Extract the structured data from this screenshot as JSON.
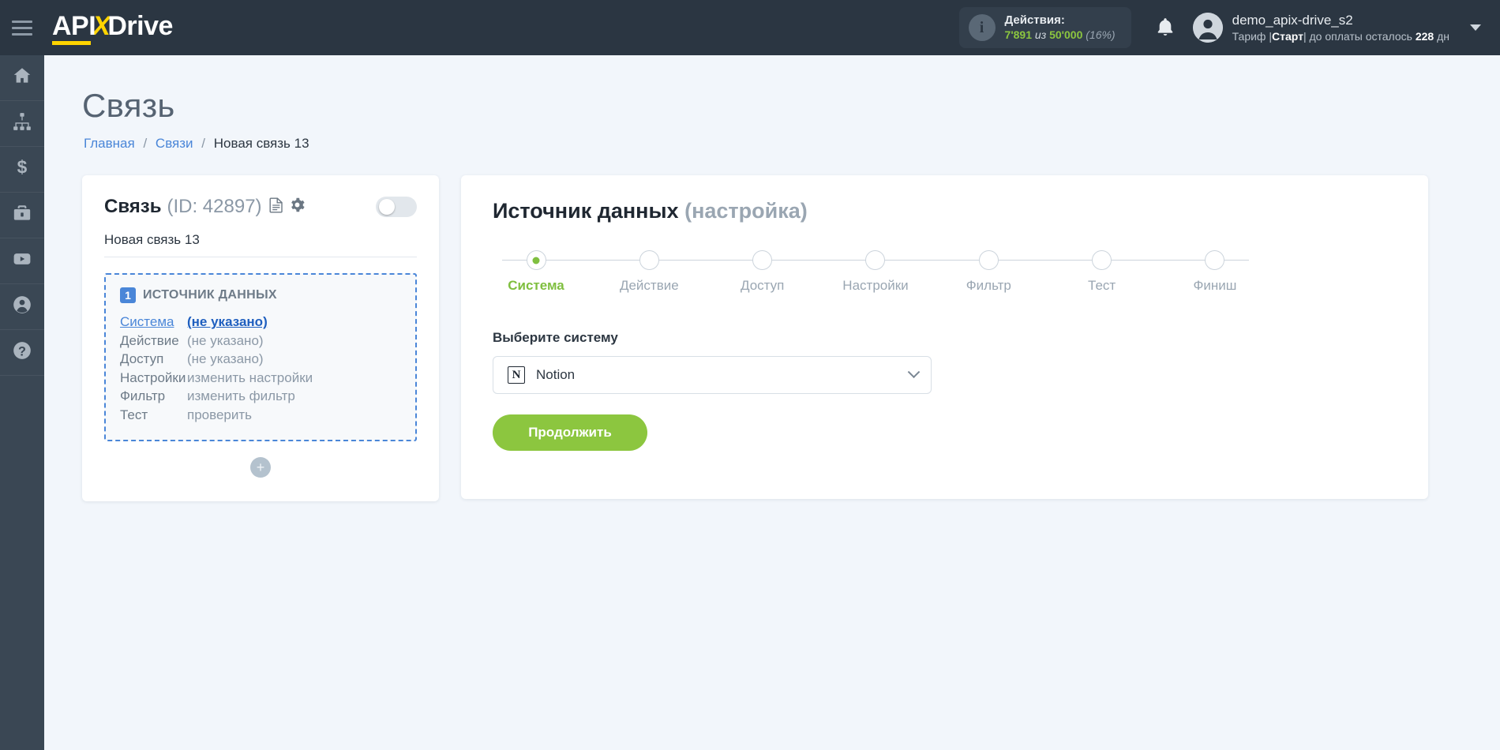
{
  "topbar": {
    "menu_icon": "hamburger-icon",
    "logo": {
      "part1": "API",
      "part2": "X",
      "part3": "Drive"
    },
    "actions": {
      "icon": "info-icon",
      "title": "Действия:",
      "used": "7'891",
      "of": "из",
      "total": "50'000",
      "percent": "(16%)"
    },
    "notifications_icon": "bell-icon",
    "user": {
      "avatar_icon": "user-avatar-icon",
      "name": "demo_apix-drive_s2",
      "plan_prefix": "Тариф |",
      "plan_name": "Старт",
      "plan_suffix": "| до оплаты осталось ",
      "days": "228",
      "days_unit": " дн"
    },
    "caret_icon": "chevron-down-icon"
  },
  "rail": {
    "items": [
      {
        "icon": "home-icon",
        "name": "home"
      },
      {
        "icon": "sitemap-icon",
        "name": "connections"
      },
      {
        "icon": "dollar-icon",
        "name": "billing"
      },
      {
        "icon": "briefcase-icon",
        "name": "business"
      },
      {
        "icon": "youtube-icon",
        "name": "video"
      },
      {
        "icon": "account-icon",
        "name": "account"
      },
      {
        "icon": "question-icon",
        "name": "help"
      }
    ]
  },
  "page": {
    "title": "Связь",
    "breadcrumb": {
      "home": "Главная",
      "links": "Связи",
      "current": "Новая связь 13",
      "separator": "/"
    }
  },
  "link_card": {
    "title": "Связь",
    "id_text": "(ID: 42897)",
    "doc_icon": "document-icon",
    "gear_icon": "gear-icon",
    "toggle_state": "off",
    "link_name": "Новая связь 13",
    "block": {
      "number": "1",
      "title": "ИСТОЧНИК ДАННЫХ",
      "rows": [
        {
          "key": "Система",
          "value": "(не указано)",
          "active": true
        },
        {
          "key": "Действие",
          "value": "(не указано)",
          "active": false
        },
        {
          "key": "Доступ",
          "value": "(не указано)",
          "active": false
        },
        {
          "key": "Настройки",
          "value": "изменить настройки",
          "active": false
        },
        {
          "key": "Фильтр",
          "value": "изменить фильтр",
          "active": false
        },
        {
          "key": "Тест",
          "value": "проверить",
          "active": false
        }
      ]
    },
    "add_button_label": "+",
    "add_button_icon": "plus-icon"
  },
  "setup": {
    "title_main": "Источник данных",
    "title_dim": "(настройка)",
    "steps": [
      {
        "label": "Система",
        "state": "done"
      },
      {
        "label": "Действие",
        "state": "pending"
      },
      {
        "label": "Доступ",
        "state": "pending"
      },
      {
        "label": "Настройки",
        "state": "pending"
      },
      {
        "label": "Фильтр",
        "state": "pending"
      },
      {
        "label": "Тест",
        "state": "pending"
      },
      {
        "label": "Финиш",
        "state": "pending"
      }
    ],
    "field_label": "Выберите систему",
    "select": {
      "icon": "notion-icon",
      "icon_glyph": "N",
      "value": "Notion",
      "chevron_icon": "chevron-down-icon"
    },
    "continue_label": "Продолжить"
  },
  "colors": {
    "topbar_bg": "#2b3642",
    "rail_bg": "#3a4754",
    "page_bg": "#f2f6fb",
    "accent_yellow": "#ffd400",
    "accent_green": "#8cc63f",
    "accent_blue": "#4a86d8"
  }
}
